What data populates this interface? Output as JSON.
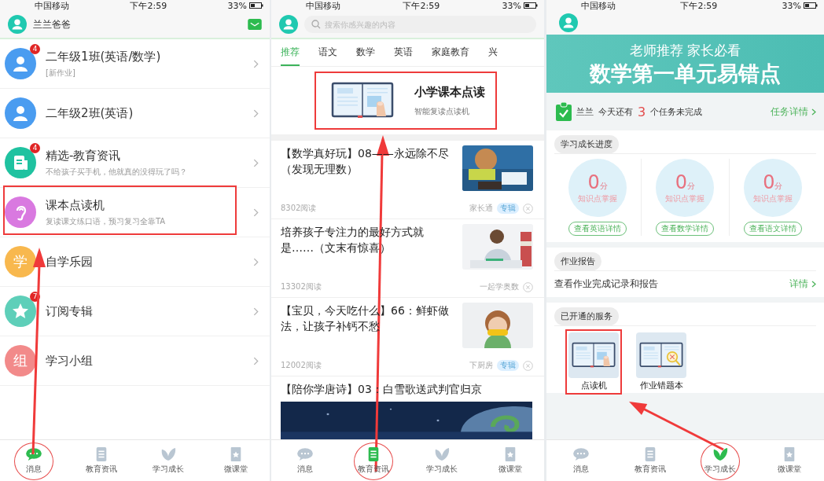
{
  "screen_1": {
    "status_bar": {
      "carrier": "中国移动",
      "time": "下午2:59",
      "battery": "33%"
    },
    "header": {
      "user_name": "兰兰爸爸"
    },
    "items": [
      {
        "kind": "person",
        "color": "#4a9cf0",
        "badge": "4",
        "title": "二年级1班(英语/数学)",
        "subtitle": "[新作业]",
        "highlighted": false
      },
      {
        "kind": "person",
        "color": "#4a9cf0",
        "title": "二年级2班(英语)",
        "highlighted": false
      },
      {
        "kind": "news",
        "color": "#1fc2a0",
        "badge": "4",
        "title": "精选-教育资讯",
        "subtitle": "不给孩子买手机，他就真的没得玩了吗？",
        "highlighted": false
      },
      {
        "kind": "ear",
        "color": "#d979e0",
        "title": "课本点读机",
        "subtitle": "复读课文练口语，预习复习全靠TA",
        "highlighted": true
      },
      {
        "kind": "text",
        "color": "#f8b84e",
        "avatar_text": "学",
        "title": "自学乐园",
        "highlighted": false
      },
      {
        "kind": "star",
        "color": "#5ecfb9",
        "badge": "7",
        "title": "订阅专辑",
        "highlighted": false
      },
      {
        "kind": "text",
        "color": "#f28a8a",
        "avatar_text": "组",
        "title": "学习小组",
        "highlighted": false
      }
    ],
    "tab_bar": {
      "tabs": [
        {
          "label": "消息",
          "selected": true,
          "circled": true
        },
        {
          "label": "教育资讯",
          "selected": false,
          "circled": false
        },
        {
          "label": "学习成长",
          "selected": false,
          "circled": false
        },
        {
          "label": "微课堂",
          "selected": false,
          "circled": false
        }
      ]
    }
  },
  "screen_2": {
    "status_bar": {
      "carrier": "中国移动",
      "time": "下午2:59",
      "battery": "33%"
    },
    "search": {
      "placeholder": "搜索你感兴趣的内容"
    },
    "categories": [
      {
        "label": "推荐",
        "selected": true
      },
      {
        "label": "语文",
        "selected": false
      },
      {
        "label": "数学",
        "selected": false
      },
      {
        "label": "英语",
        "selected": false
      },
      {
        "label": "家庭教育",
        "selected": false
      },
      {
        "label": "兴",
        "selected": false
      }
    ],
    "promo": {
      "title": "小学课本点读",
      "subtitle": "智能复读点读机",
      "highlighted": true
    },
    "articles": [
      {
        "title": "【数学真好玩】08——永远除不尽（发现无理数）",
        "reads": "8302阅读",
        "source": "家长通",
        "tag": "专辑"
      },
      {
        "title": "培养孩子专注力的最好方式就是……（文末有惊喜）",
        "reads": "13302阅读",
        "source": "一起学奥数"
      },
      {
        "title": "【宝贝，今天吃什么】66：鲜虾做法，让孩子补钙不愁",
        "reads": "12002阅读",
        "source": "下厨房",
        "tag": "专辑"
      }
    ],
    "featured": {
      "title": "【陪你学唐诗】03：白雪歌送武判官归京"
    },
    "tab_bar": {
      "tabs": [
        {
          "label": "消息",
          "selected": false,
          "circled": false
        },
        {
          "label": "教育资讯",
          "selected": true,
          "circled": true
        },
        {
          "label": "学习成长",
          "selected": false,
          "circled": false
        },
        {
          "label": "微课堂",
          "selected": false,
          "circled": false
        }
      ]
    }
  },
  "screen_3": {
    "status_bar": {
      "carrier": "中国移动",
      "time": "下午2:59",
      "battery": "33%"
    },
    "banner": {
      "line_1": "老师推荐 家长必看",
      "line_2": "数学第一单元易错点"
    },
    "tasks": {
      "name": "兰兰",
      "text": "今天还有",
      "count": "3",
      "suffix": "个任务未完成",
      "link": "任务详情"
    },
    "progress": {
      "heading": "学习成长进度",
      "cards": [
        {
          "score": "0",
          "unit": "分",
          "caption": "知识点掌握",
          "button": "查看英语详情"
        },
        {
          "score": "0",
          "unit": "分",
          "caption": "知识点掌握",
          "button": "查看数学详情"
        },
        {
          "score": "0",
          "unit": "分",
          "caption": "知识点掌握",
          "button": "查看语文详情"
        }
      ]
    },
    "report": {
      "heading": "作业报告",
      "text": "查看作业完成记录和报告",
      "link": "详情"
    },
    "services": {
      "heading": "已开通的服务",
      "items": [
        {
          "label": "点读机",
          "highlighted": true
        },
        {
          "label": "作业错题本",
          "highlighted": false
        }
      ]
    },
    "tab_bar": {
      "tabs": [
        {
          "label": "消息",
          "selected": false,
          "circled": false
        },
        {
          "label": "教育资讯",
          "selected": false,
          "circled": false
        },
        {
          "label": "学习成长",
          "selected": true,
          "circled": true
        },
        {
          "label": "微课堂",
          "selected": false,
          "circled": false
        }
      ]
    }
  }
}
